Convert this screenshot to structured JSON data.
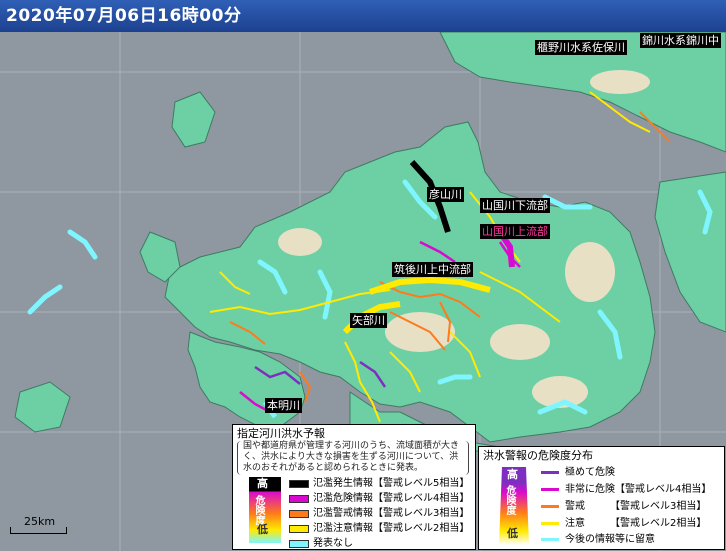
{
  "header": {
    "timestamp": "2020年07月06日16時00分"
  },
  "colors": {
    "sea": "#8f98a0",
    "land": "#6dd0a4",
    "highland": "#e7e0c4",
    "river_outline": "#1a1a1a",
    "none": "#7ff6ff",
    "caution": "#ffea00",
    "warning": "#ff7a1a",
    "danger": "#d80ad0",
    "flood": "#000000",
    "very_high": "#7d2fbf"
  },
  "river_labels": [
    {
      "text": "彦山川",
      "style": "normal"
    },
    {
      "text": "山国川下流部",
      "style": "normal"
    },
    {
      "text": "山国川上流部",
      "style": "pink"
    },
    {
      "text": "筑後川上中流部",
      "style": "normal"
    },
    {
      "text": "矢部川",
      "style": "normal"
    },
    {
      "text": "本明川",
      "style": "normal"
    },
    {
      "text": "櫃野川水系佐保川",
      "style": "normal"
    },
    {
      "text": "錦川水系錦川中",
      "style": "normal"
    }
  ],
  "forecast_legend": {
    "title": "指定河川洪水予報",
    "description": "国や都道府県が管理する河川のうち、流域面積が大きく、洪水により大きな損害を生ずる河川について、洪水のおそれがあると認められるときに発表。",
    "level_labels": {
      "high": "高",
      "mid": "危険度",
      "low": "低"
    },
    "items": [
      {
        "label": "氾濫発生情報【警戒レベル5相当】",
        "color": "#000000"
      },
      {
        "label": "氾濫危険情報【警戒レベル4相当】",
        "color": "#d80ad0"
      },
      {
        "label": "氾濫警戒情報【警戒レベル3相当】",
        "color": "#ff7a1a"
      },
      {
        "label": "氾濫注意情報【警戒レベル2相当】",
        "color": "#ffea00"
      },
      {
        "label": "発表なし",
        "color": "#7ff6ff"
      }
    ]
  },
  "warning_legend": {
    "title": "洪水警報の危険度分布",
    "level_labels": {
      "high": "高",
      "mid": "危険度",
      "low": "低"
    },
    "items": [
      {
        "label": "極めて危険",
        "color": "#7d2fbf"
      },
      {
        "label": "非常に危険【警戒レベル4相当】",
        "color": "#d80ad0"
      },
      {
        "label": "警戒　　　【警戒レベル3相当】",
        "color": "#ff7a1a"
      },
      {
        "label": "注意　　　【警戒レベル2相当】",
        "color": "#ffea00"
      },
      {
        "label": "今後の情報等に留意",
        "color": "#ffffff"
      }
    ]
  },
  "scale": {
    "label": "25km"
  }
}
